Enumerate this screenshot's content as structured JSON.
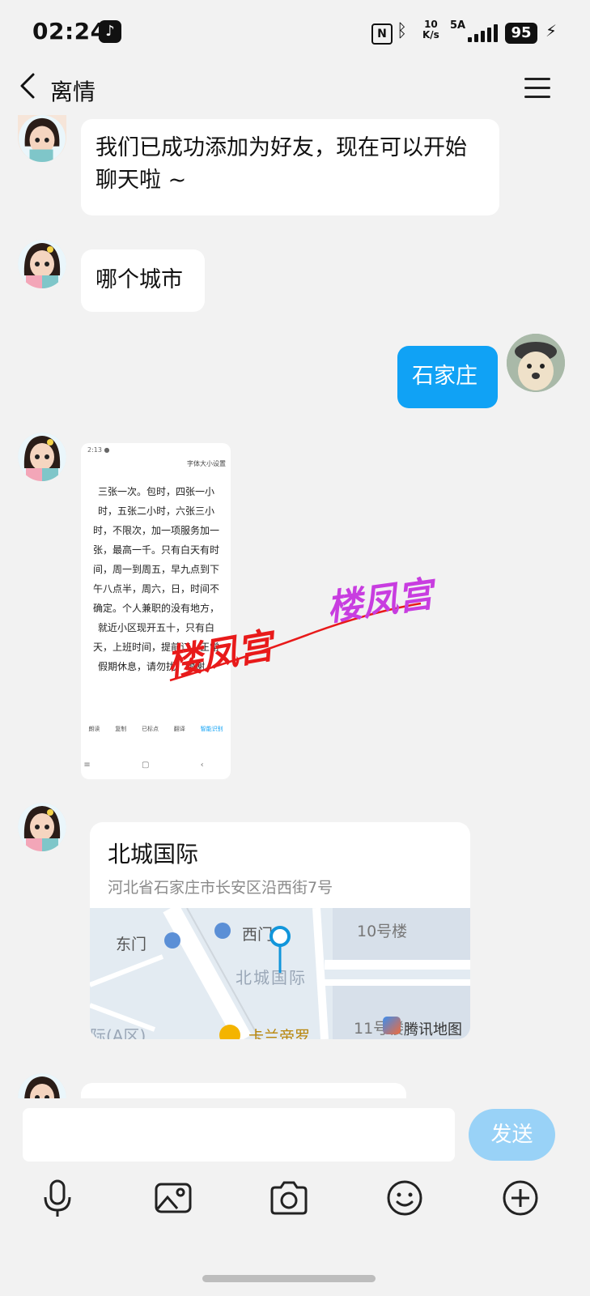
{
  "status_bar": {
    "time": "02:24",
    "speed": "10\nK/s",
    "speed_top": "10",
    "speed_bottom": "K/s",
    "signal_label": "5A",
    "battery": "95"
  },
  "header": {
    "title": "离情"
  },
  "messages": {
    "m1": "我们已成功添加为好友，现在可以开始聊天啦 ~",
    "m2": "哪个城市",
    "m3": "石家庄",
    "image_text": "三张一次。包时，四张一小时，五张二小时，六张三小时，不限次，加一项服务加一张，最高一千。只有白天有时间，周一到周五，早九点到下午八点半，周六，日，时间不确定。个人兼职的没有地方，就近小区现开五十，只有白天，上班时间，提前订。正常假期休息，请勿扰，谢谢。",
    "image_top_right": "字体大小设置",
    "image_toolbar": [
      "朗读",
      "复制",
      "已标点",
      "翻译",
      "智能识别"
    ],
    "watermark_1": "楼凤宫",
    "watermark_2": "楼凤宫"
  },
  "location": {
    "name": "北城国际",
    "address": "河北省石家庄市长安区沿西街7号",
    "map_labels": {
      "east_gate": "东门",
      "west_gate": "西门",
      "building10": "10号楼",
      "poi": "北城国际",
      "building11": "11号楼",
      "area": "际(A区)",
      "shop": "卡兰帝罗",
      "provider": "腾讯地图"
    }
  },
  "input_bar": {
    "placeholder": "",
    "send_label": "发送"
  },
  "colors": {
    "accent": "#10a2f5",
    "send_disabled": "#99d2f7",
    "background": "#f2f2f2"
  }
}
